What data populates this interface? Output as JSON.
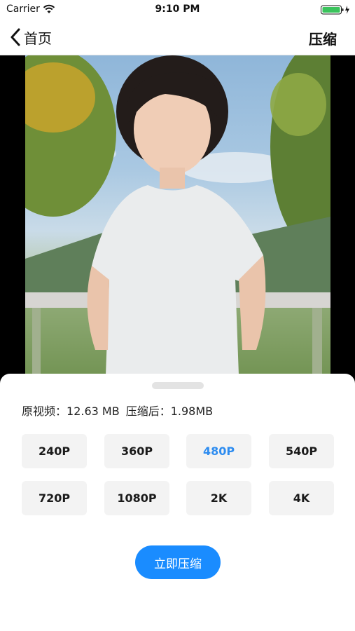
{
  "status_bar": {
    "carrier": "Carrier",
    "time": "9:10 PM"
  },
  "nav": {
    "back_label": "首页",
    "action_label": "压缩"
  },
  "sheet": {
    "original_label": "原视频：",
    "original_size": "12.63 MB",
    "compressed_label": "压缩后：",
    "compressed_size": "1.98MB",
    "resolutions": [
      "240P",
      "360P",
      "480P",
      "540P",
      "720P",
      "1080P",
      "2K",
      "4K"
    ],
    "selected_resolution": "480P",
    "compress_button": "立即压缩"
  },
  "colors": {
    "accent": "#1a8cff",
    "selected_text": "#2d8cf0",
    "button_bg": "#f3f3f3"
  }
}
